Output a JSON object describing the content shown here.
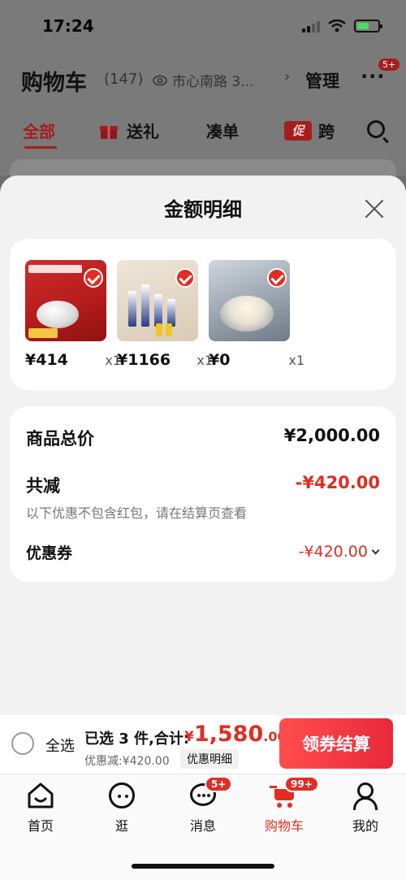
{
  "status": {
    "time": "17:24"
  },
  "background": {
    "title": "购物车",
    "count": "(147)",
    "location": "市心南路 3...",
    "manage": "管理",
    "more_badge": "5+",
    "tabs": [
      "全部",
      "送礼",
      "凑单",
      "跨"
    ],
    "tab_icons": [
      "gift-icon",
      "promo-icon"
    ]
  },
  "sheet": {
    "title": "金额明细",
    "products": [
      {
        "price": "¥414",
        "qty": "x1"
      },
      {
        "price": "¥1166",
        "qty": "x1"
      },
      {
        "price": "¥0",
        "qty": "x1"
      }
    ],
    "summary": {
      "total_label": "商品总价",
      "total_value": "¥2,000.00",
      "reduce_label": "共减",
      "reduce_value": "-¥420.00",
      "note": "以下优惠不包含红包，请在结算页查看",
      "coupon_label": "优惠券",
      "coupon_value": "-¥420.00"
    }
  },
  "checkout": {
    "select_all": "全选",
    "selected_text": "已选 3 件,合计:",
    "currency": "¥",
    "amount_int": "1,580",
    "amount_dec": ".00",
    "discount_line": "优惠减:¥420.00",
    "detail_tag": "优惠明细",
    "button": "领券结算"
  },
  "tabbar": {
    "items": [
      {
        "label": "首页",
        "icon": "home-icon"
      },
      {
        "label": "逛",
        "icon": "browse-icon"
      },
      {
        "label": "消息",
        "icon": "message-icon",
        "badge": "5+"
      },
      {
        "label": "购物车",
        "icon": "cart-icon",
        "badge": "99+",
        "active": true
      },
      {
        "label": "我的",
        "icon": "profile-icon"
      }
    ]
  },
  "colors": {
    "accent": "#e02e24",
    "dim_overlay": "#7a7a7a",
    "sheet_bg": "#f2f2f2"
  }
}
